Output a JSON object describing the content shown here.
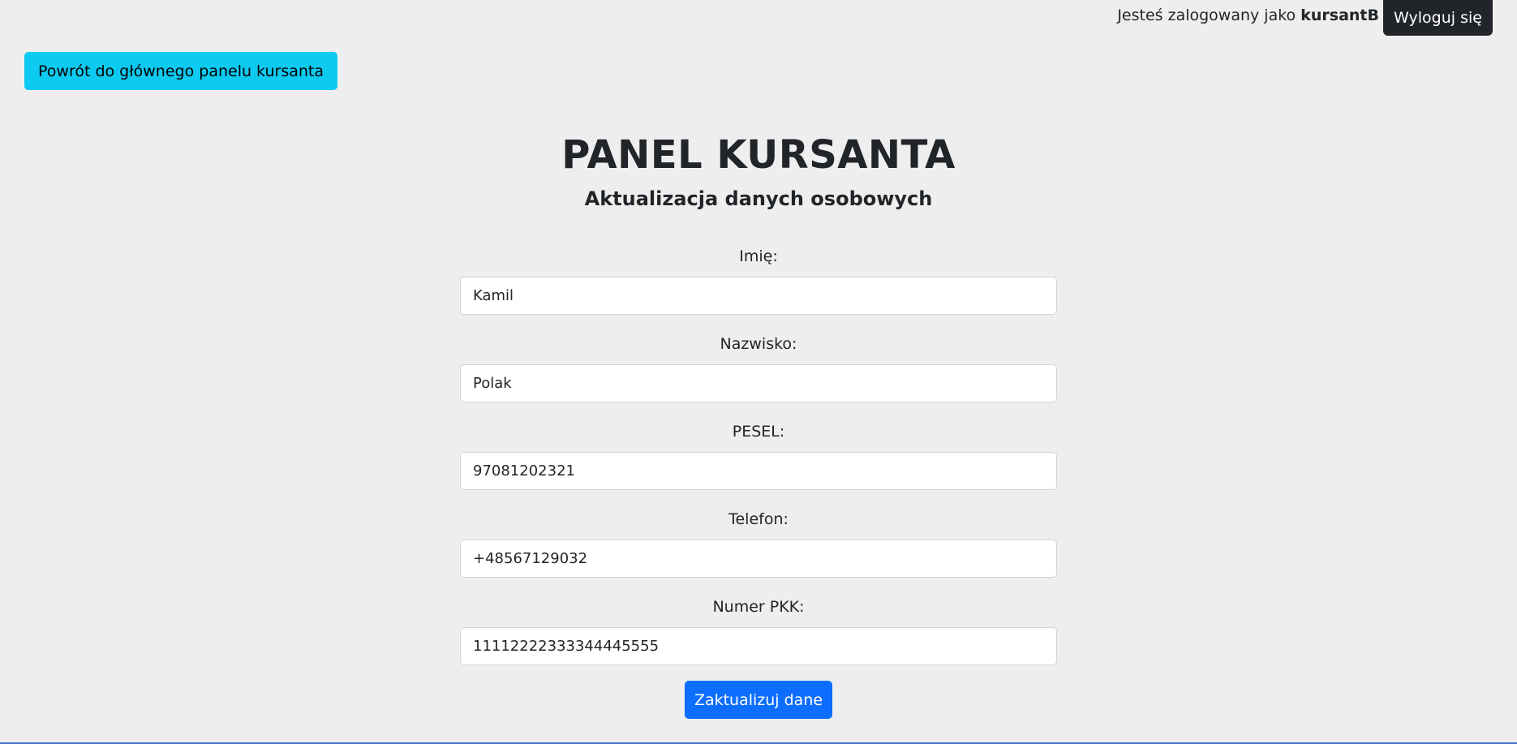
{
  "header": {
    "login_prefix": "Jesteś zalogowany jako",
    "username": "kursantB",
    "logout_label": "Wyloguj się"
  },
  "nav": {
    "back_label": "Powrót do głównego panelu kursanta"
  },
  "page": {
    "title": "PANEL KURSANTA",
    "subtitle": "Aktualizacja danych osobowych"
  },
  "form": {
    "fields": [
      {
        "label": "Imię:",
        "value": "Kamil"
      },
      {
        "label": "Nazwisko:",
        "value": "Polak"
      },
      {
        "label": "PESEL:",
        "value": "97081202321"
      },
      {
        "label": "Telefon:",
        "value": "+48567129032"
      },
      {
        "label": "Numer PKK:",
        "value": "11112222333344445555"
      }
    ],
    "submit_label": "Zaktualizuj dane"
  },
  "colors": {
    "background": "#eeeeee",
    "logout_button": "#212529",
    "back_button": "#0dcaf0",
    "submit_button": "#0d6efd"
  }
}
